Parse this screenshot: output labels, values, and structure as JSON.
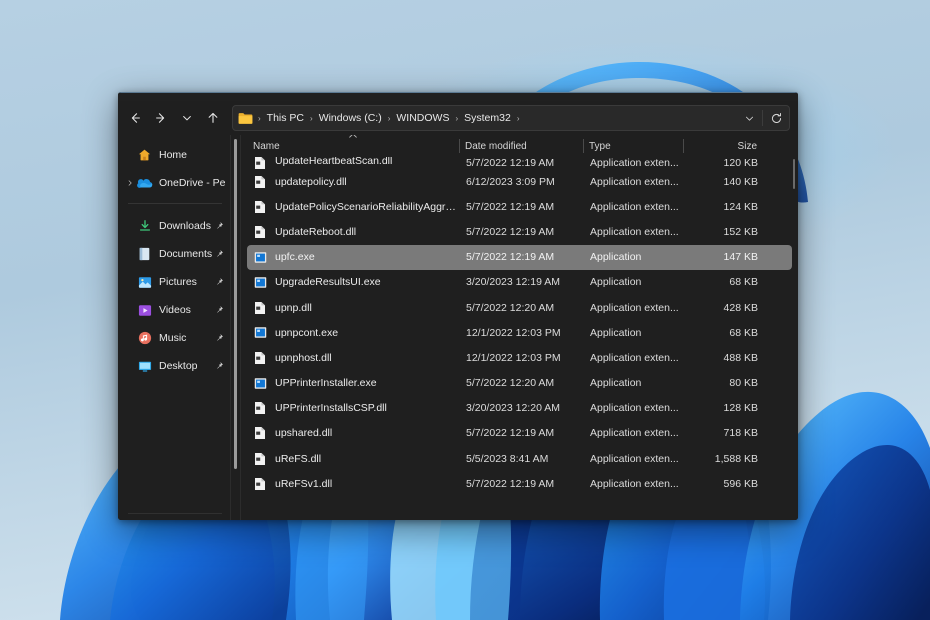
{
  "window": {
    "title": "System32",
    "accent_color": "#1f1f1f",
    "selection_color": "#7a7a7a"
  },
  "toolbar": {
    "back_label": "Back",
    "forward_label": "Forward",
    "recent_label": "Recent locations",
    "up_label": "Up to Windows",
    "refresh_label": "Refresh",
    "dropdown_label": "Previous locations"
  },
  "address": {
    "folder_icon": "folder-icon",
    "separator": "›",
    "crumbs": [
      {
        "label": "This PC"
      },
      {
        "label": "Windows (C:)"
      },
      {
        "label": "WINDOWS"
      },
      {
        "label": "System32"
      }
    ]
  },
  "sidebar": {
    "items": [
      {
        "label": "Home",
        "icon": "home-icon",
        "pinned": false,
        "expandable": false
      },
      {
        "label": "OneDrive - Pers",
        "icon": "onedrive-cloud-icon",
        "pinned": false,
        "expandable": true
      }
    ],
    "quick_access": [
      {
        "label": "Downloads",
        "icon": "downloads-icon",
        "pinned": true
      },
      {
        "label": "Documents",
        "icon": "documents-icon",
        "pinned": true
      },
      {
        "label": "Pictures",
        "icon": "pictures-icon",
        "pinned": true
      },
      {
        "label": "Videos",
        "icon": "videos-icon",
        "pinned": true
      },
      {
        "label": "Music",
        "icon": "music-icon",
        "pinned": true
      },
      {
        "label": "Desktop",
        "icon": "desktop-icon",
        "pinned": true
      }
    ]
  },
  "columns": {
    "name": "Name",
    "date_modified": "Date modified",
    "type": "Type",
    "size": "Size",
    "sort_column": "Name",
    "sort_direction": "ascending"
  },
  "files": [
    {
      "name": "UpdateHeartbeatScan.dll",
      "date": "5/7/2022 12:19 AM",
      "type": "Application exten...",
      "size": "120 KB",
      "icon": "dll-file-icon",
      "selected": false,
      "clipped": true
    },
    {
      "name": "updatepolicy.dll",
      "date": "6/12/2023 3:09 PM",
      "type": "Application exten...",
      "size": "140 KB",
      "icon": "dll-file-icon",
      "selected": false
    },
    {
      "name": "UpdatePolicyScenarioReliabilityAggregat...",
      "date": "5/7/2022 12:19 AM",
      "type": "Application exten...",
      "size": "124 KB",
      "icon": "dll-file-icon",
      "selected": false
    },
    {
      "name": "UpdateReboot.dll",
      "date": "5/7/2022 12:19 AM",
      "type": "Application exten...",
      "size": "152 KB",
      "icon": "dll-file-icon",
      "selected": false
    },
    {
      "name": "upfc.exe",
      "date": "5/7/2022 12:19 AM",
      "type": "Application",
      "size": "147 KB",
      "icon": "exe-file-icon",
      "selected": true
    },
    {
      "name": "UpgradeResultsUI.exe",
      "date": "3/20/2023 12:19 AM",
      "type": "Application",
      "size": "68 KB",
      "icon": "exe-file-icon",
      "selected": false
    },
    {
      "name": "upnp.dll",
      "date": "5/7/2022 12:20 AM",
      "type": "Application exten...",
      "size": "428 KB",
      "icon": "dll-file-icon",
      "selected": false
    },
    {
      "name": "upnpcont.exe",
      "date": "12/1/2022 12:03 PM",
      "type": "Application",
      "size": "68 KB",
      "icon": "exe-file-icon",
      "selected": false
    },
    {
      "name": "upnphost.dll",
      "date": "12/1/2022 12:03 PM",
      "type": "Application exten...",
      "size": "488 KB",
      "icon": "dll-file-icon",
      "selected": false
    },
    {
      "name": "UPPrinterInstaller.exe",
      "date": "5/7/2022 12:20 AM",
      "type": "Application",
      "size": "80 KB",
      "icon": "exe-file-icon",
      "selected": false
    },
    {
      "name": "UPPrinterInstallsCSP.dll",
      "date": "3/20/2023 12:20 AM",
      "type": "Application exten...",
      "size": "128 KB",
      "icon": "dll-file-icon",
      "selected": false
    },
    {
      "name": "upshared.dll",
      "date": "5/7/2022 12:19 AM",
      "type": "Application exten...",
      "size": "718 KB",
      "icon": "dll-file-icon",
      "selected": false
    },
    {
      "name": "uReFS.dll",
      "date": "5/5/2023 8:41 AM",
      "type": "Application exten...",
      "size": "1,588 KB",
      "icon": "dll-file-icon",
      "selected": false
    },
    {
      "name": "uReFSv1.dll",
      "date": "5/7/2022 12:19 AM",
      "type": "Application exten...",
      "size": "596 KB",
      "icon": "dll-file-icon",
      "selected": false
    }
  ]
}
